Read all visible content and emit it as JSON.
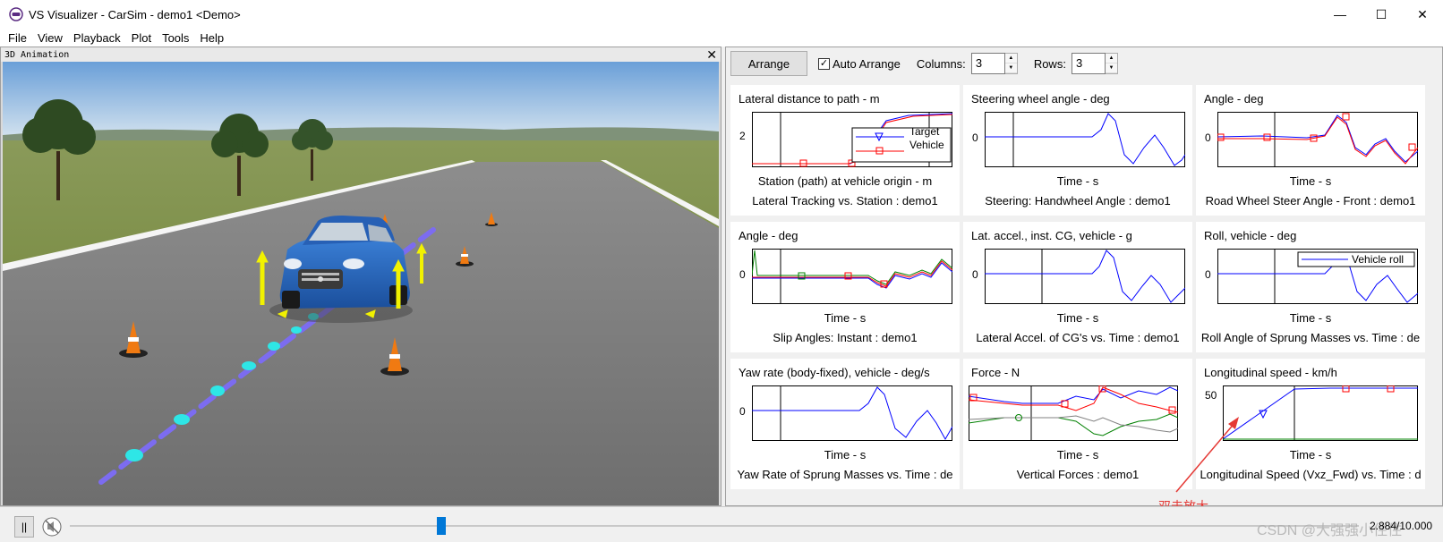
{
  "window": {
    "title": "VS Visualizer - CarSim - demo1 <Demo>",
    "minimize": "—",
    "maximize": "☐",
    "close": "✕"
  },
  "menu": [
    "File",
    "View",
    "Playback",
    "Plot",
    "Tools",
    "Help"
  ],
  "animation": {
    "header": "3D Animation",
    "close": "✕"
  },
  "toolbar": {
    "arrange": "Arrange",
    "auto_arrange": "Auto Arrange",
    "auto_arrange_checked": true,
    "columns_label": "Columns:",
    "columns_value": "3",
    "rows_label": "Rows:",
    "rows_value": "3"
  },
  "plots": [
    {
      "title": "Lateral distance to path - m",
      "xlabel": "Station (path) at vehicle origin - m",
      "caption": "Lateral Tracking vs. Station : demo1",
      "ytick": "2",
      "legend": [
        "Target",
        "Vehicle"
      ]
    },
    {
      "title": "Steering wheel angle - deg",
      "xlabel": "Time - s",
      "caption": "Steering: Handwheel Angle : demo1",
      "ytick": "0",
      "legend": []
    },
    {
      "title": "Angle - deg",
      "xlabel": "Time - s",
      "caption": "Road Wheel Steer Angle - Front : demo1",
      "ytick": "0",
      "legend": []
    },
    {
      "title": "Angle - deg",
      "xlabel": "Time - s",
      "caption": "Slip Angles: Instant : demo1",
      "ytick": "0",
      "legend": []
    },
    {
      "title": "Lat. accel., inst. CG, vehicle - g",
      "xlabel": "Time - s",
      "caption": "Lateral Accel. of CG's vs. Time : demo1",
      "ytick": "0",
      "legend": []
    },
    {
      "title": "Roll, vehicle - deg",
      "xlabel": "Time - s",
      "caption": "Roll Angle of Sprung Masses vs. Time : de",
      "ytick": "0",
      "legend": [
        "Vehicle roll"
      ]
    },
    {
      "title": "Yaw rate (body-fixed), vehicle - deg/s",
      "xlabel": "Time - s",
      "caption": "Yaw Rate of Sprung Masses vs. Time : de",
      "ytick": "0",
      "legend": []
    },
    {
      "title": "Force - N",
      "xlabel": "Time - s",
      "caption": "Vertical Forces : demo1",
      "ytick": "",
      "legend": []
    },
    {
      "title": "Longitudinal speed - km/h",
      "xlabel": "Time - s",
      "caption": "Longitudinal Speed (Vxz_Fwd) vs. Time : d",
      "ytick": "50",
      "legend": []
    }
  ],
  "playback": {
    "time": "2.884/10.000",
    "progress": 0.288,
    "pause": "||"
  },
  "annotation": "双击放大",
  "watermark": "CSDN @大强强小住住",
  "colors": {
    "accent": "#0078d7",
    "series_blue": "#0000ff",
    "series_red": "#ff0000",
    "series_green": "#008000",
    "annotation": "#e53935"
  }
}
